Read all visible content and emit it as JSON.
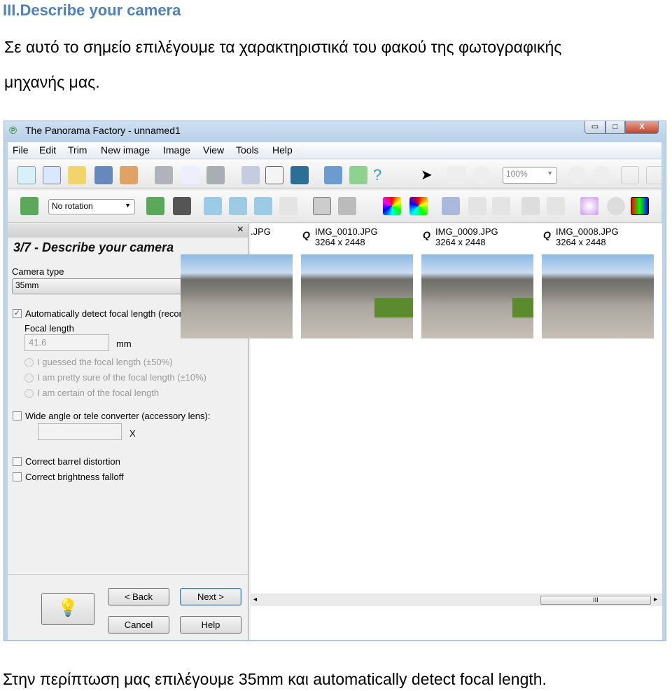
{
  "doc": {
    "heading": "III.Describe your camera",
    "para_line1": "Σε αυτό το σημείο επιλέγουμε τα χαρακτηριστικά του φακού της φωτογραφικής",
    "para_line2": "μηχανής μας.",
    "caption": "Στην περίπτωση μας επιλέγουμε 35mm και automatically detect focal length."
  },
  "window": {
    "title": "The Panorama Factory - unnamed1",
    "minimize": "▭",
    "maximize": "□",
    "close": "X"
  },
  "menu": [
    "File",
    "Edit",
    "Trim",
    "New image",
    "Image",
    "View",
    "Tools",
    "Help"
  ],
  "toolbar": {
    "zoom_value": "100%",
    "rotation_value": "No rotation"
  },
  "panel": {
    "close": "×",
    "title": "3/7 - Describe your camera",
    "camera_type_label": "Camera type",
    "camera_type_value": "35mm",
    "auto_detect_label": "Automatically detect focal length (recommended)",
    "auto_detect_checked": true,
    "focal_length_label": "Focal length",
    "focal_length_value": "41.6",
    "focal_unit": "mm",
    "radios": [
      "I guessed the focal length (±50%)",
      "I am pretty sure of the focal length (±10%)",
      "I am certain of the focal length"
    ],
    "converter_label": "Wide angle or tele converter (accessory lens):",
    "converter_unit": "X",
    "barrel_label": "Correct barrel distortion",
    "brightness_label": "Correct brightness falloff",
    "back": "< Back",
    "next": "Next >",
    "cancel": "Cancel",
    "help": "Help"
  },
  "images": [
    {
      "name": ".JPG",
      "size": ""
    },
    {
      "name": "IMG_0010.JPG",
      "size": "3264 x 2448"
    },
    {
      "name": "IMG_0009.JPG",
      "size": "3264 x 2448"
    },
    {
      "name": "IMG_0008.JPG",
      "size": "3264 x 2448"
    }
  ],
  "scroll": {
    "thumb": "III"
  },
  "colors": {
    "heading": "#4f81bd"
  }
}
